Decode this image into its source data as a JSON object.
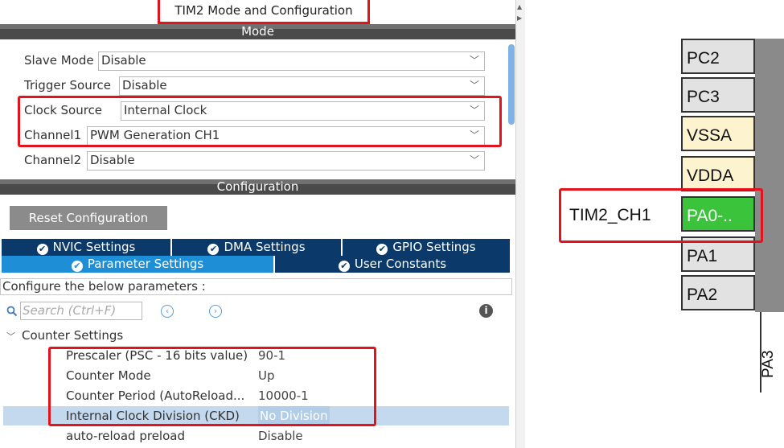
{
  "panel_title": "TIM2 Mode and Configuration",
  "mode_header": "Mode",
  "mode_rows": [
    {
      "label": "Slave Mode",
      "value": "Disable"
    },
    {
      "label": "Trigger Source",
      "value": "Disable"
    },
    {
      "label": "Clock Source",
      "value": "Internal Clock"
    },
    {
      "label": "Channel1",
      "value": "PWM Generation CH1"
    },
    {
      "label": "Channel2",
      "value": "Disable"
    }
  ],
  "config_header": "Configuration",
  "reset_button": "Reset Configuration",
  "tabs": {
    "nvic": "NVIC Settings",
    "dma": "DMA Settings",
    "gpio": "GPIO Settings",
    "parameter": "Parameter Settings",
    "user_constants": "User Constants"
  },
  "configure_text": "Configure the below parameters :",
  "search_placeholder": "Search (Ctrl+F)",
  "section": "Counter Settings",
  "params": [
    {
      "name": "Prescaler (PSC - 16 bits value)",
      "value": "90-1"
    },
    {
      "name": "Counter Mode",
      "value": "Up"
    },
    {
      "name": "Counter Period (AutoReload...",
      "value": "10000-1"
    },
    {
      "name": "Internal Clock Division (CKD)",
      "value": "No Division"
    },
    {
      "name": "auto-reload preload",
      "value": "Disable"
    }
  ],
  "pins": [
    "PC2",
    "PC3",
    "VSSA",
    "VDDA",
    "PA0-..",
    "PA1",
    "PA2"
  ],
  "pin_signal": "TIM2_CH1",
  "pin_partial": "PA3",
  "colors": {
    "highlight_red": "#e3121b",
    "tab_dark": "#0b3a6a",
    "tab_active": "#1e8fd6",
    "pin_green": "#3bc43b"
  },
  "icons": {
    "checkmark": "check-circle-icon",
    "search": "search-icon",
    "info": "info-icon"
  }
}
